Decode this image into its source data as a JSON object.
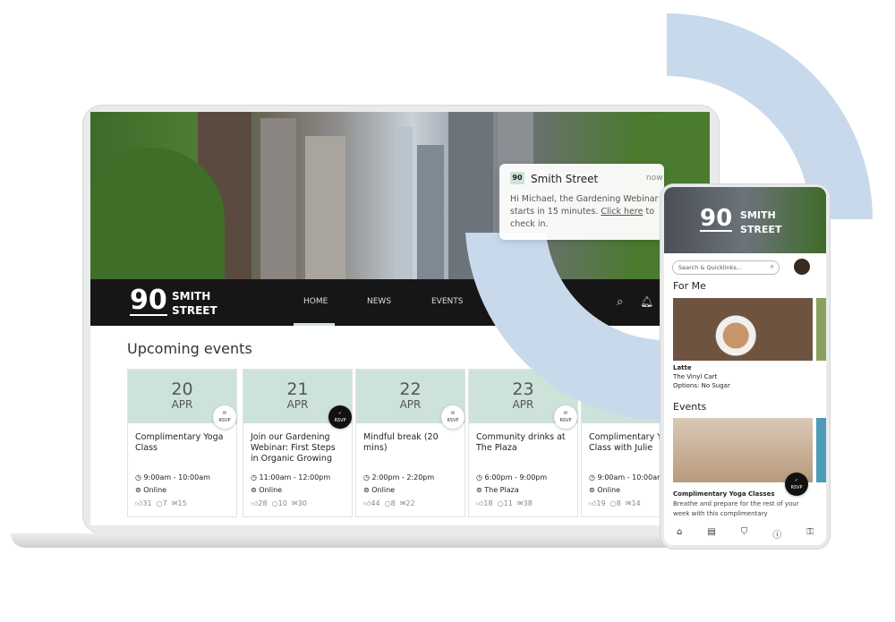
{
  "brand": {
    "number": "90",
    "line1": "SMITH",
    "line2": "STREET"
  },
  "nav": {
    "items": [
      "HOME",
      "NEWS",
      "EVENTS"
    ],
    "active": "HOME"
  },
  "section_title": "Upcoming events",
  "events": [
    {
      "day": "20",
      "month": "APR",
      "title": "Complimentary Yoga Class",
      "time": "9:00am - 10:00am",
      "location": "Online",
      "likes": "31",
      "comments": "7",
      "rsvps": "15",
      "rsvped": false
    },
    {
      "day": "21",
      "month": "APR",
      "title": "Join our Gardening Webinar: First Steps in Organic Growing",
      "time": "11:00am - 12:00pm",
      "location": "Online",
      "likes": "28",
      "comments": "10",
      "rsvps": "30",
      "rsvped": true
    },
    {
      "day": "22",
      "month": "APR",
      "title": "Mindful break (20 mins)",
      "time": "2:00pm - 2:20pm",
      "location": "Online",
      "likes": "44",
      "comments": "8",
      "rsvps": "22",
      "rsvped": false
    },
    {
      "day": "23",
      "month": "APR",
      "title": "Community drinks at The Plaza",
      "time": "6:00pm - 9:00pm",
      "location": "The Plaza",
      "likes": "18",
      "comments": "11",
      "rsvps": "38",
      "rsvped": false
    },
    {
      "day": "",
      "month": "",
      "title": "Complimentary Yoga Class with Julie",
      "time": "9:00am - 10:00am",
      "location": "Online",
      "likes": "19",
      "comments": "8",
      "rsvps": "14",
      "rsvped": false
    }
  ],
  "rsvp_label": "RSVP",
  "notification": {
    "app": "Smith Street",
    "badge": "90",
    "time": "now",
    "text_before": "Hi Michael, the Gardening Webinar starts in 15 minutes. ",
    "link": "Click here",
    "text_after": " to check in."
  },
  "phone": {
    "search_placeholder": "Search & Quicklinks...",
    "for_me": "For Me",
    "item": {
      "name": "Latte",
      "vendor": "The Vinyl Cart",
      "options": "Options: No Sugar"
    },
    "events_title": "Events",
    "event": {
      "title": "Complimentary Yoga Classes",
      "desc": "Breathe and prepare for the rest of your week with this complimentary"
    },
    "tabs": [
      "home-icon",
      "news-icon",
      "shop-icon",
      "info-icon",
      "key-icon"
    ]
  },
  "colors": {
    "accent": "#cde3da",
    "arc": "#c9d9ec",
    "nav": "#161616"
  }
}
